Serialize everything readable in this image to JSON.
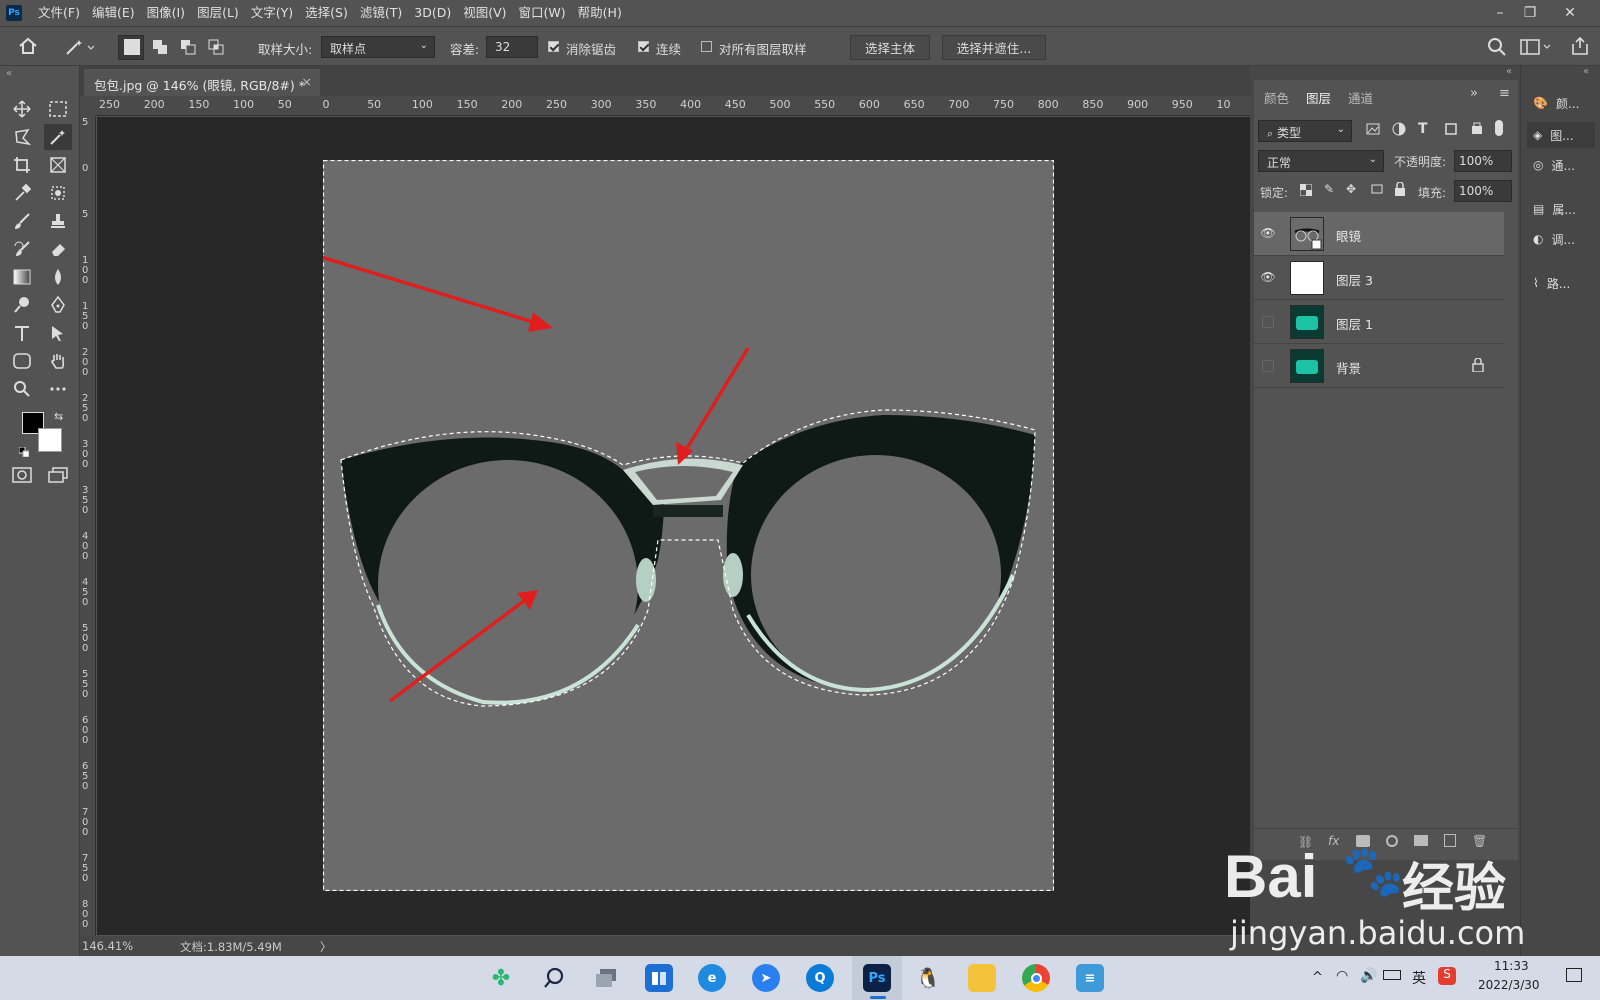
{
  "app": {
    "logo": "Ps"
  },
  "menu": [
    "文件(F)",
    "编辑(E)",
    "图像(I)",
    "图层(L)",
    "文字(Y)",
    "选择(S)",
    "滤镜(T)",
    "3D(D)",
    "视图(V)",
    "窗口(W)",
    "帮助(H)"
  ],
  "window_controls": {
    "minimize": "–",
    "restore": "❐",
    "close": "✕"
  },
  "options": {
    "sample_size_label": "取样大小:",
    "sample_size_value": "取样点",
    "tolerance_label": "容差:",
    "tolerance_value": "32",
    "antialias_label": "消除锯齿",
    "antialias_checked": true,
    "contiguous_label": "连续",
    "contiguous_checked": true,
    "sample_all_label": "对所有图层取样",
    "sample_all_checked": false,
    "select_subject": "选择主体",
    "select_and_mask": "选择并遮住..."
  },
  "document": {
    "tab_title": "包包.jpg @ 146% (眼镜, RGB/8#) *",
    "close": "×"
  },
  "ruler_top": [
    "250",
    "200",
    "150",
    "100",
    "50",
    "0",
    "50",
    "100",
    "150",
    "200",
    "250",
    "300",
    "350",
    "400",
    "450",
    "500",
    "550",
    "600",
    "650",
    "700",
    "750",
    "800",
    "850",
    "900",
    "950",
    "10"
  ],
  "ruler_left": [
    "5",
    "0",
    "5",
    "1 0 0",
    "1 5 0",
    "2 0 0",
    "2 5 0",
    "3 0 0",
    "3 5 0",
    "4 0 0",
    "4 5 0",
    "5 0 0",
    "5 5 0",
    "6 0 0",
    "6 5 0",
    "7 0 0",
    "7 5 0",
    "8 0 0"
  ],
  "status": {
    "zoom": "146.41%",
    "doc": "文档:1.83M/5.49M",
    "arrow": "〉"
  },
  "panel": {
    "tabs": [
      "颜色",
      "图层",
      "通道"
    ],
    "active_tab": "图层",
    "filter_kind": "类型",
    "blend_mode": "正常",
    "opacity_label": "不透明度:",
    "opacity_value": "100%",
    "lock_label": "锁定:",
    "fill_label": "填充:",
    "fill_value": "100%",
    "layers": [
      {
        "name": "眼镜",
        "visible": true,
        "selected": true,
        "thumb": "glasses"
      },
      {
        "name": "图层 3",
        "visible": true,
        "selected": false,
        "thumb": "white"
      },
      {
        "name": "图层 1",
        "visible": false,
        "selected": false,
        "thumb": "bag"
      },
      {
        "name": "背景",
        "visible": false,
        "selected": false,
        "thumb": "bag",
        "locked": true
      }
    ],
    "footer_fx": "fx"
  },
  "dock": [
    "颜...",
    "图...",
    "通...",
    "属...",
    "调...",
    "路..."
  ],
  "taskbar": {
    "icons": [
      "widgets-icon",
      "search-icon",
      "taskview-icon",
      "store-icon",
      "edge-icon",
      "feishu-icon",
      "browser-icon",
      "photoshop-icon",
      "qq-icon",
      "explorer-icon",
      "chrome-icon",
      "notepad-icon"
    ],
    "ps_label": "Ps",
    "ime": "英",
    "time": "11:33",
    "date": "2022/3/30"
  },
  "watermark": {
    "brand": "Bai",
    "brand2": "经验",
    "url": "jingyan.baidu.com"
  }
}
